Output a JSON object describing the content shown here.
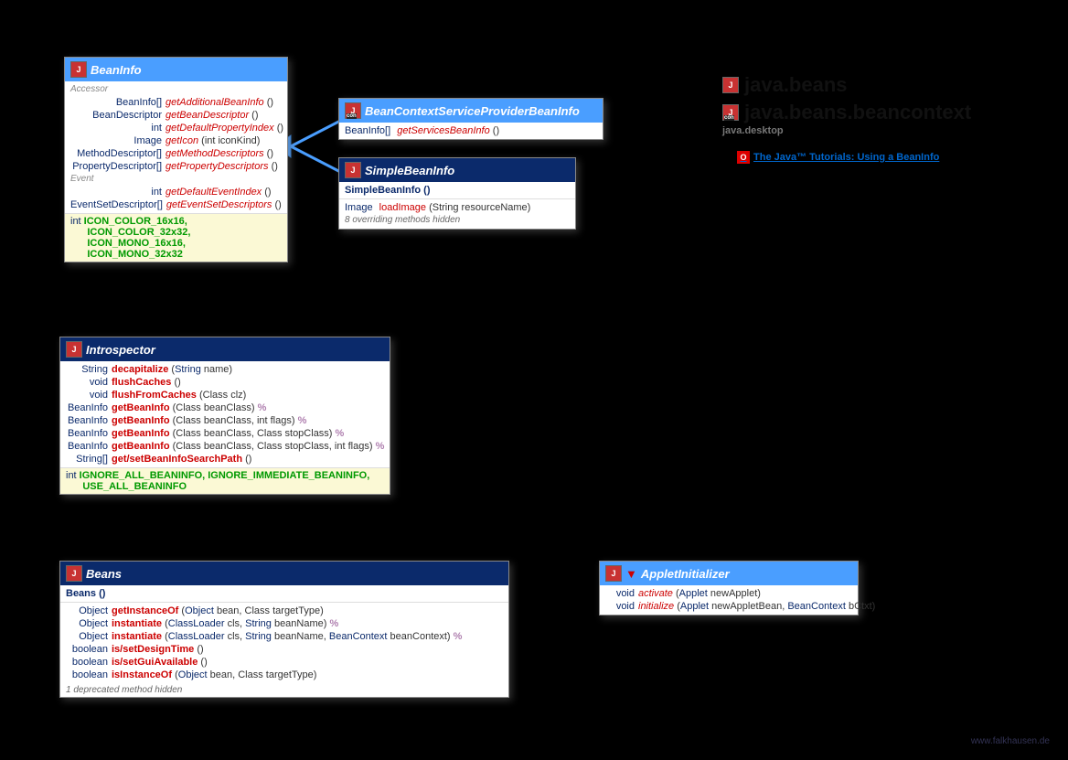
{
  "packages": {
    "p1": "java.beans",
    "p2": "java.beans.beancontext",
    "module": "java.desktop"
  },
  "tutorial_link": "The Java™ Tutorials: Using a BeanInfo",
  "watermark": "www.falkhausen.de",
  "beanInfo": {
    "title": "BeanInfo",
    "sect1": "Accessor",
    "rows1": [
      {
        "ret": "BeanInfo[]",
        "m": "getAdditionalBeanInfo",
        "p": "()"
      },
      {
        "ret": "BeanDescriptor",
        "m": "getBeanDescriptor",
        "p": "()"
      },
      {
        "ret": "int",
        "m": "getDefaultPropertyIndex",
        "p": "()"
      },
      {
        "ret": "Image",
        "m": "getIcon",
        "p": "(int iconKind)"
      },
      {
        "ret": "MethodDescriptor[]",
        "m": "getMethodDescriptors",
        "p": "()"
      },
      {
        "ret": "PropertyDescriptor[]",
        "m": "getPropertyDescriptors",
        "p": "()"
      }
    ],
    "sect2": "Event",
    "rows2": [
      {
        "ret": "int",
        "m": "getDefaultEventIndex",
        "p": "()"
      },
      {
        "ret": "EventSetDescriptor[]",
        "m": "getEventSetDescriptors",
        "p": "()"
      }
    ],
    "consts": "int ICON_COLOR_16x16,\n    ICON_COLOR_32x32,\n    ICON_MONO_16x16,\n    ICON_MONO_32x32"
  },
  "bcsp": {
    "title": "BeanContextServiceProviderBeanInfo",
    "row": {
      "ret": "BeanInfo[]",
      "m": "getServicesBeanInfo",
      "p": "()"
    }
  },
  "simple": {
    "title": "SimpleBeanInfo",
    "ctor": "SimpleBeanInfo ()",
    "row": {
      "ret": "Image",
      "m": "loadImage",
      "p": "(String resourceName)"
    },
    "note": "8 overriding methods hidden"
  },
  "introspector": {
    "title": "Introspector",
    "rows": [
      {
        "ret": "String",
        "m": "decapitalize",
        "p": "(String name)",
        "th": false
      },
      {
        "ret": "void",
        "m": "flushCaches",
        "p": "()",
        "th": false
      },
      {
        "ret": "void",
        "m": "flushFromCaches",
        "p": "(Class<?> clz)",
        "th": false
      },
      {
        "ret": "BeanInfo",
        "m": "getBeanInfo",
        "p": "(Class<?> beanClass)",
        "th": true
      },
      {
        "ret": "BeanInfo",
        "m": "getBeanInfo",
        "p": "(Class<?> beanClass, int flags)",
        "th": true
      },
      {
        "ret": "BeanInfo",
        "m": "getBeanInfo",
        "p": "(Class<?> beanClass, Class<?> stopClass)",
        "th": true
      },
      {
        "ret": "BeanInfo",
        "m": "getBeanInfo",
        "p": "(Class<?> beanClass, Class<?> stopClass, int flags)",
        "th": true
      },
      {
        "ret": "String[]",
        "m": "get/setBeanInfoSearchPath",
        "p": "()",
        "th": false
      }
    ],
    "consts": "int IGNORE_ALL_BEANINFO, IGNORE_IMMEDIATE_BEANINFO,\n    USE_ALL_BEANINFO"
  },
  "beans": {
    "title": "Beans",
    "ctor": "Beans ()",
    "rows": [
      {
        "ret": "Object",
        "m": "getInstanceOf",
        "p": "(Object bean, Class<?> targetType)",
        "th": false
      },
      {
        "ret": "Object",
        "m": "instantiate",
        "p": "(ClassLoader cls, String beanName)",
        "th": true
      },
      {
        "ret": "Object",
        "m": "instantiate",
        "p": "(ClassLoader cls, String beanName, BeanContext beanContext)",
        "th": true
      },
      {
        "ret": "boolean",
        "m": "is/setDesignTime",
        "p": "()",
        "th": false
      },
      {
        "ret": "boolean",
        "m": "is/setGuiAvailable",
        "p": "()",
        "th": false
      },
      {
        "ret": "boolean",
        "m": "isInstanceOf",
        "p": "(Object bean, Class<?> targetType)",
        "th": false
      }
    ],
    "note": "1 deprecated method hidden"
  },
  "applet": {
    "title": "AppletInitializer",
    "rows": [
      {
        "ret": "void",
        "m": "activate",
        "p": "(Applet newApplet)"
      },
      {
        "ret": "void",
        "m": "initialize",
        "p": "(Applet newAppletBean, BeanContext bCtxt)"
      }
    ]
  }
}
